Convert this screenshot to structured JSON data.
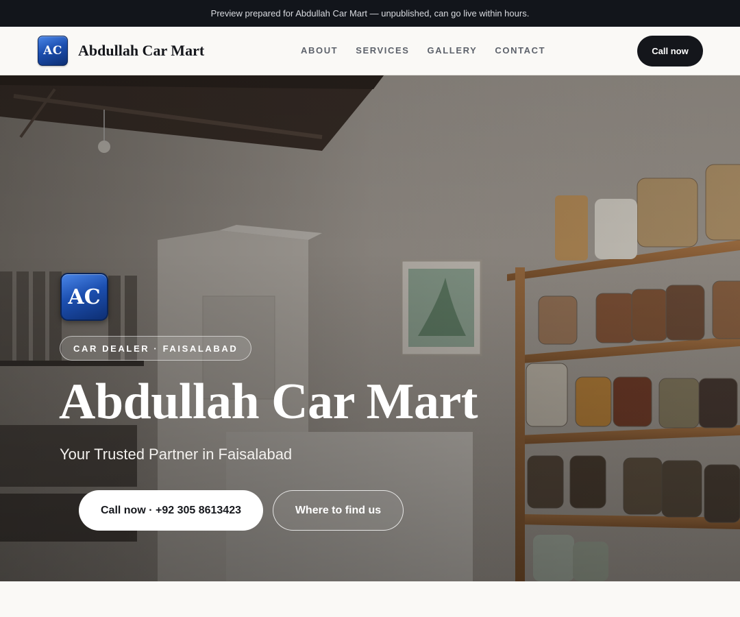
{
  "banner": {
    "text": "Preview prepared for Abdullah Car Mart — unpublished, can go live within hours."
  },
  "header": {
    "logo_initials": "AC",
    "brand_name": "Abdullah Car Mart",
    "nav": [
      {
        "label": "ABOUT"
      },
      {
        "label": "SERVICES"
      },
      {
        "label": "GALLERY"
      },
      {
        "label": "CONTACT"
      }
    ],
    "call_label": "Call now"
  },
  "hero": {
    "logo_initials": "AC",
    "tag": "CAR DEALER · FAISALABAD",
    "title": "Abdullah Car Mart",
    "subtitle": "Your Trusted Partner in Faisalabad",
    "primary_button": "Call now · +92 305 8613423",
    "secondary_button": "Where to find us"
  },
  "colors": {
    "banner_bg": "#12151b",
    "header_bg": "#faf9f6",
    "brand_accent": "#1c4fb0",
    "dark_button": "#14161b"
  }
}
